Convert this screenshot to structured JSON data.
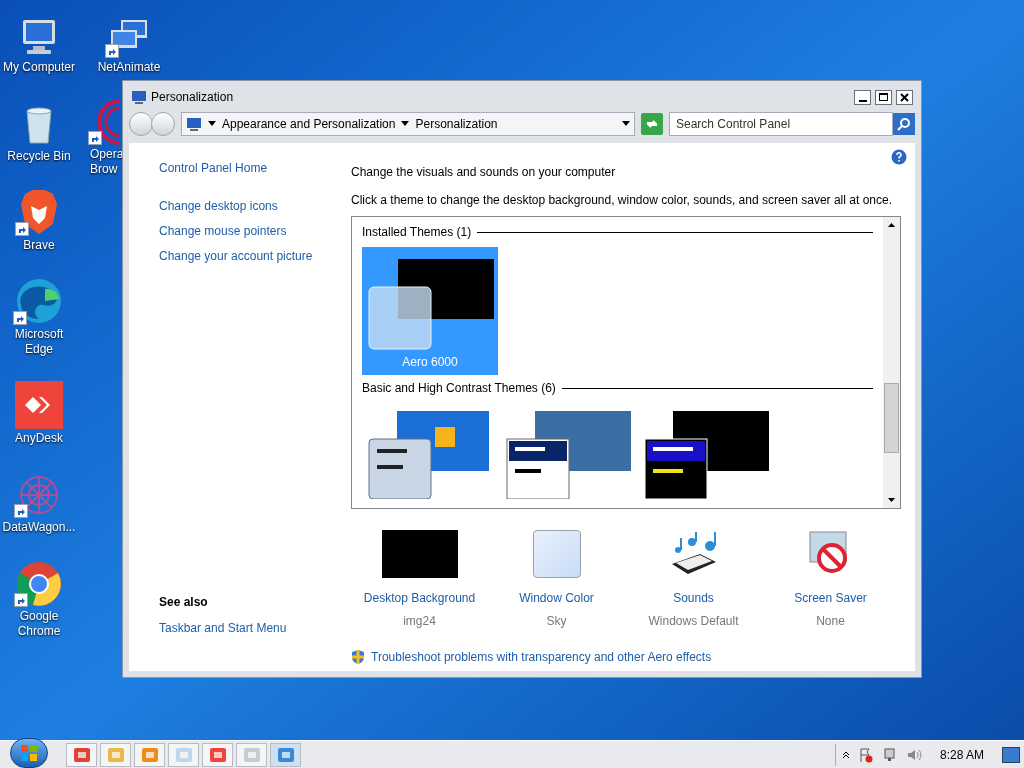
{
  "desktop_icons": [
    {
      "label": "My Computer",
      "kind": "computer",
      "shortcut": false
    },
    {
      "label": "Recycle Bin",
      "kind": "recycle",
      "shortcut": false
    },
    {
      "label": "Brave",
      "kind": "brave",
      "shortcut": true
    },
    {
      "label": "Microsoft Edge",
      "kind": "edge",
      "shortcut": true
    },
    {
      "label": "AnyDesk",
      "kind": "anydesk",
      "shortcut": false
    },
    {
      "label": "DataWagon...",
      "kind": "datawagon",
      "shortcut": true
    },
    {
      "label": "Google Chrome",
      "kind": "chrome",
      "shortcut": true
    }
  ],
  "desktop_icons_column_2": [
    {
      "label": "NetAnimate",
      "kind": "network",
      "shortcut": true
    },
    {
      "label": "Opera Brow",
      "kind": "opera",
      "shortcut": true
    }
  ],
  "window": {
    "title": "Personalization",
    "breadcrumb": [
      "Appearance and Personalization",
      "Personalization"
    ],
    "search": {
      "placeholder": "Search Control Panel"
    },
    "sidebar": {
      "home": "Control Panel Home",
      "tasks": [
        "Change desktop icons",
        "Change mouse pointers",
        "Change your account picture"
      ],
      "see_also": {
        "title": "See also",
        "links": [
          "Taskbar and Start Menu"
        ]
      }
    },
    "heading": "Change the visuals and sounds on your computer",
    "description": "Click a theme to change the desktop background, window color, sounds, and screen saver all at once.",
    "theme_groups": [
      {
        "title": "Installed Themes (1)",
        "themes": [
          {
            "name": "Aero 6000",
            "kind": "aero",
            "selected": true
          }
        ]
      },
      {
        "title": "Basic and High Contrast Themes (6)",
        "themes": [
          {
            "kind": "basic",
            "selected": false
          },
          {
            "kind": "classic",
            "selected": false
          },
          {
            "kind": "high-contrast",
            "selected": false
          }
        ]
      }
    ],
    "settings": [
      {
        "kind": "background",
        "label": "Desktop Background",
        "value": "img24"
      },
      {
        "kind": "color",
        "label": "Window Color",
        "value": "Sky"
      },
      {
        "kind": "sounds",
        "label": "Sounds",
        "value": "Windows Default"
      },
      {
        "kind": "screensaver",
        "label": "Screen Saver",
        "value": "None"
      }
    ],
    "troubleshoot": "Troubleshoot problems with transparency and other Aero effects"
  },
  "taskbar": {
    "apps": [
      {
        "kind": "chrome"
      },
      {
        "kind": "folder"
      },
      {
        "kind": "media"
      },
      {
        "kind": "notepad"
      },
      {
        "kind": "anydesk"
      },
      {
        "kind": "paint"
      },
      {
        "kind": "control-panel"
      }
    ],
    "clock": "8:28 AM"
  }
}
